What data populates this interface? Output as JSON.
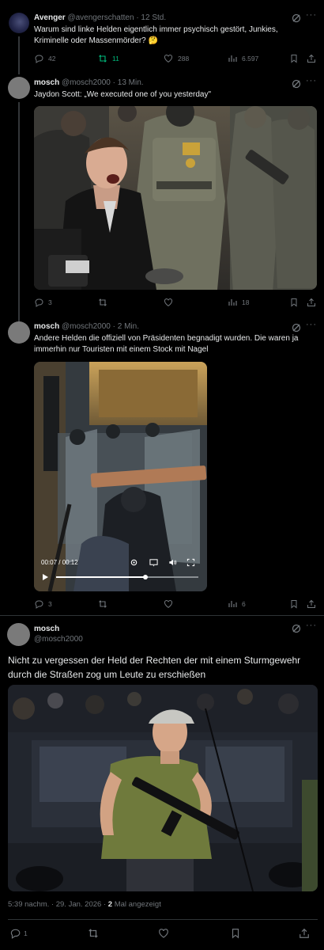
{
  "post1": {
    "name": "Avenger",
    "handle": "@avengerschatten",
    "time": "· 12 Std.",
    "text": "Warum sind linke Helden eigentlich immer psychisch gestört, Junkies, Kriminelle oder Massenmörder? 🤔",
    "replies": "42",
    "reposts": "11",
    "likes": "288",
    "views": "6.597",
    "repost_color": "#00ba7c"
  },
  "post2": {
    "name": "mosch",
    "handle": "@mosch2000",
    "time": "· 13 Min.",
    "text": "Jaydon Scott: „We executed one of you yesterday\"",
    "replies": "3",
    "reposts": "",
    "likes": "",
    "views": "18"
  },
  "post3": {
    "name": "mosch",
    "handle": "@mosch2000",
    "time": "· 2 Min.",
    "text": "Andere Helden die offiziell von Präsidenten begnadigt wurden. Die waren ja immerhin nur Touristen mit einem Stock mit Nagel",
    "video_time": "00:07 / 00:12",
    "replies": "3",
    "reposts": "",
    "likes": "",
    "views": "6"
  },
  "main_post": {
    "name": "mosch",
    "handle": "@mosch2000",
    "text": "Nicht zu vergessen der Held der Rechten der mit einem Sturmgewehr durch die Straßen zog um Leute zu erschießen",
    "timestamp": "5:39 nachm. · 29. Jan. 2026 ·",
    "views_count": "2",
    "views_label": "Mal angezeigt",
    "replies": "1"
  },
  "icons": [
    "grok-icon",
    "more-icon",
    "reply-icon",
    "repost-icon",
    "like-icon",
    "views-icon",
    "bookmark-icon",
    "share-icon",
    "play-icon",
    "settings-icon",
    "captions-icon",
    "volume-icon",
    "fullscreen-icon",
    "pip-icon"
  ],
  "colors": {
    "background": "#000000",
    "text": "#e7e9ea",
    "muted": "#71767b",
    "accent_green": "#00ba7c",
    "border": "#2f3336"
  }
}
